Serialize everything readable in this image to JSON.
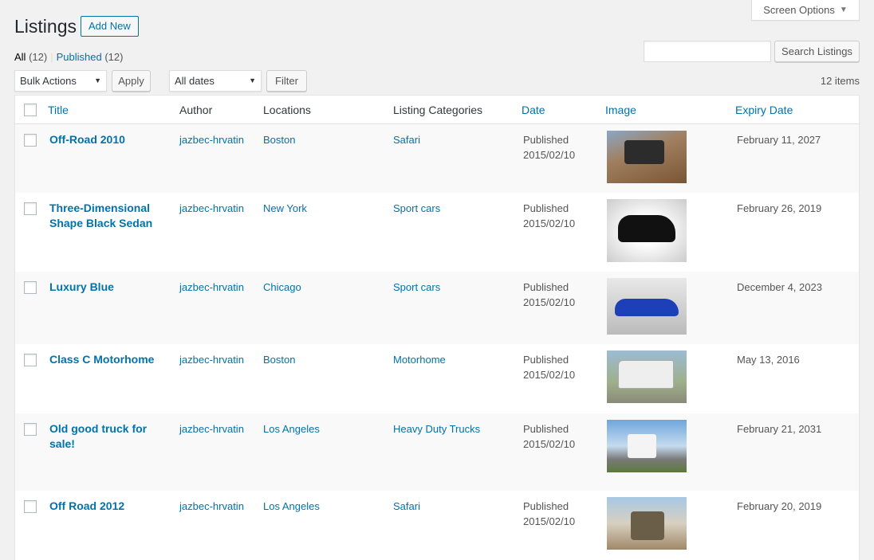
{
  "screen_options": {
    "label": "Screen Options"
  },
  "page_title": "Listings",
  "add_new_label": "Add New",
  "views": {
    "all_label": "All",
    "all_count": "(12)",
    "separator": "|",
    "published_label": "Published",
    "published_count": "(12)"
  },
  "search": {
    "button_label": "Search Listings",
    "value": ""
  },
  "bulk_actions": {
    "selected": "Bulk Actions",
    "apply_label": "Apply"
  },
  "date_filter": {
    "selected": "All dates",
    "filter_label": "Filter"
  },
  "item_count": "12 items",
  "columns": {
    "title": "Title",
    "author": "Author",
    "locations": "Locations",
    "categories": "Listing Categories",
    "date": "Date",
    "image": "Image",
    "expiry": "Expiry Date"
  },
  "rows": [
    {
      "title": "Off-Road 2010",
      "author": "jazbec-hrvatin",
      "location": "Boston",
      "category": "Safari",
      "status": "Published",
      "date": "2015/02/10",
      "image": "offroad",
      "expiry": "February 11, 2027"
    },
    {
      "title": "Three-Dimensional Shape Black Sedan",
      "author": "jazbec-hrvatin",
      "location": "New York",
      "category": "Sport cars",
      "status": "Published",
      "date": "2015/02/10",
      "image": "sedan",
      "expiry": "February 26, 2019"
    },
    {
      "title": "Luxury Blue",
      "author": "jazbec-hrvatin",
      "location": "Chicago",
      "category": "Sport cars",
      "status": "Published",
      "date": "2015/02/10",
      "image": "blue",
      "expiry": "December 4, 2023"
    },
    {
      "title": "Class C Motorhome",
      "author": "jazbec-hrvatin",
      "location": "Boston",
      "category": "Motorhome",
      "status": "Published",
      "date": "2015/02/10",
      "image": "motor",
      "expiry": "May 13, 2016"
    },
    {
      "title": "Old good truck for sale!",
      "author": "jazbec-hrvatin",
      "location": "Los Angeles",
      "category": "Heavy Duty Trucks",
      "status": "Published",
      "date": "2015/02/10",
      "image": "truck",
      "expiry": "February 21, 2031"
    },
    {
      "title": "Off Road 2012",
      "author": "jazbec-hrvatin",
      "location": "Los Angeles",
      "category": "Safari",
      "status": "Published",
      "date": "2015/02/10",
      "image": "road2012",
      "expiry": "February 20, 2019"
    }
  ]
}
